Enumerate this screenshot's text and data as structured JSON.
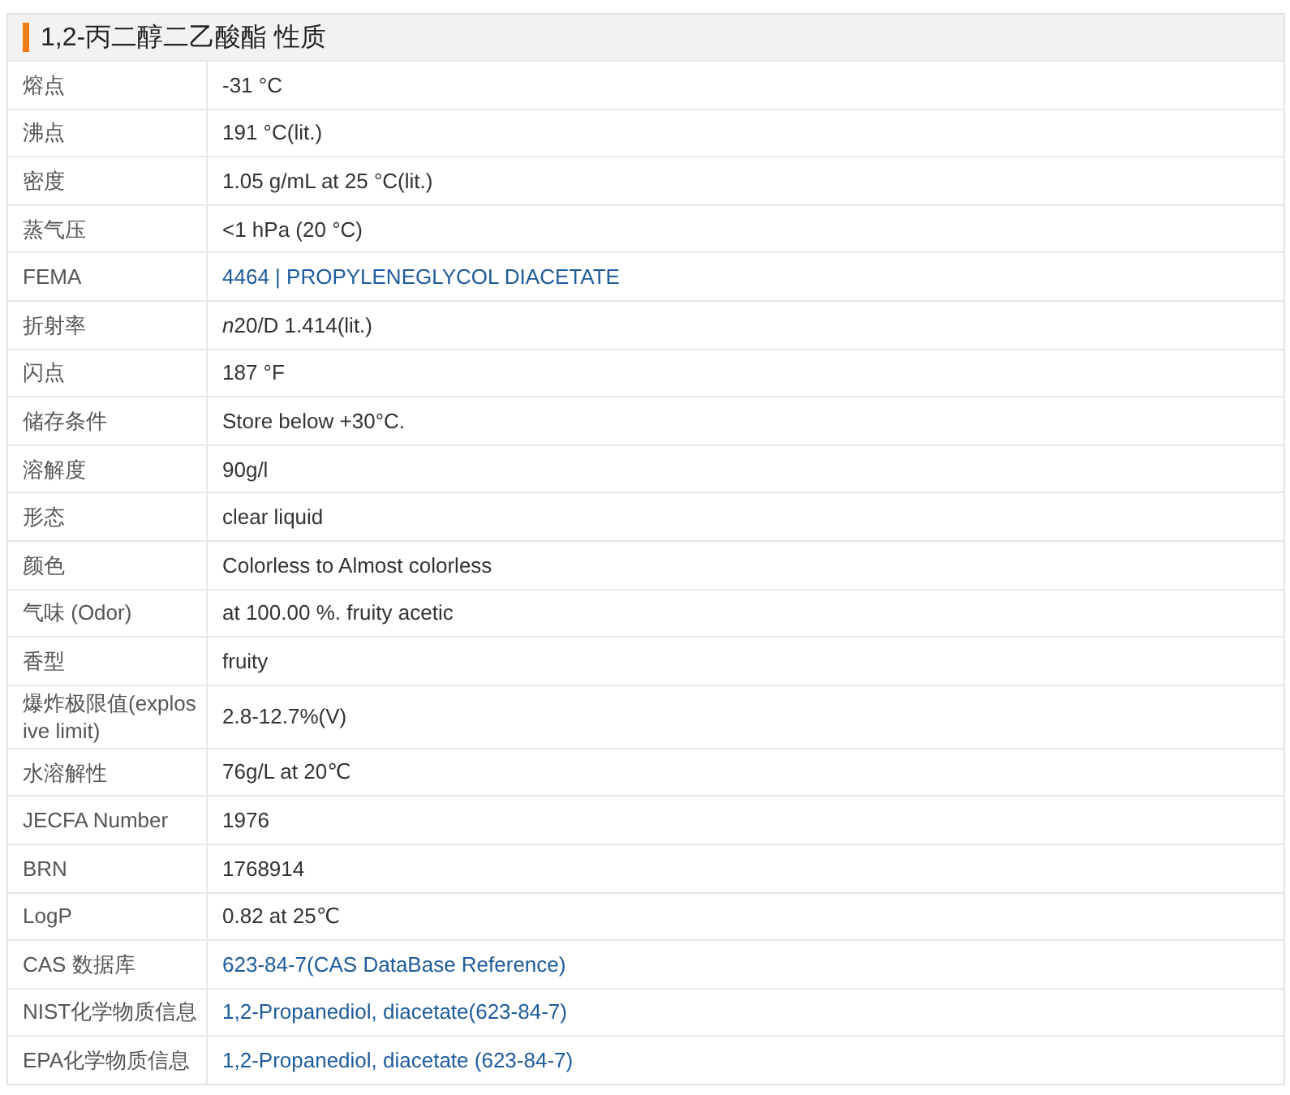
{
  "title": "1,2-丙二醇二乙酸酯 性质",
  "rows": [
    {
      "label": "熔点",
      "value": "-31 °C",
      "kind": "text"
    },
    {
      "label": "沸点",
      "value": "191 °C(lit.)",
      "kind": "text"
    },
    {
      "label": "密度",
      "value": "1.05 g/mL at 25 °C(lit.)",
      "kind": "text"
    },
    {
      "label": "蒸气压",
      "value": "<1 hPa (20 °C)",
      "kind": "text"
    },
    {
      "label": "FEMA",
      "value": "4464 | PROPYLENEGLYCOL DIACETATE",
      "kind": "link"
    },
    {
      "label": "折射率",
      "italic_prefix": "n",
      "value": "20/D 1.414(lit.)",
      "kind": "text"
    },
    {
      "label": "闪点",
      "value": "187 °F",
      "kind": "text"
    },
    {
      "label": "储存条件",
      "value": "Store below +30°C.",
      "kind": "text"
    },
    {
      "label": "溶解度",
      "value": "90g/l",
      "kind": "text"
    },
    {
      "label": "形态",
      "value": "clear liquid",
      "kind": "text"
    },
    {
      "label": "颜色",
      "value": "Colorless to Almost colorless",
      "kind": "text"
    },
    {
      "label": "气味 (Odor)",
      "value": "at 100.00 %. fruity acetic",
      "kind": "text"
    },
    {
      "label": "香型",
      "value": "fruity",
      "kind": "text"
    },
    {
      "label": "爆炸极限值(explosive limit)",
      "value": "2.8-12.7%(V)",
      "kind": "text"
    },
    {
      "label": "水溶解性",
      "value": "76g/L at 20℃",
      "kind": "text"
    },
    {
      "label": "JECFA Number",
      "value": "1976",
      "kind": "text"
    },
    {
      "label": "BRN",
      "value": "1768914",
      "kind": "text"
    },
    {
      "label": "LogP",
      "value": "0.82 at 25℃",
      "kind": "text"
    },
    {
      "label": "CAS 数据库",
      "value": "623-84-7(CAS DataBase Reference)",
      "kind": "link"
    },
    {
      "label": "NIST化学物质信息",
      "value": "1,2-Propanediol, diacetate(623-84-7)",
      "kind": "link"
    },
    {
      "label": "EPA化学物质信息",
      "value": "1,2-Propanediol, diacetate (623-84-7)",
      "kind": "link"
    }
  ]
}
